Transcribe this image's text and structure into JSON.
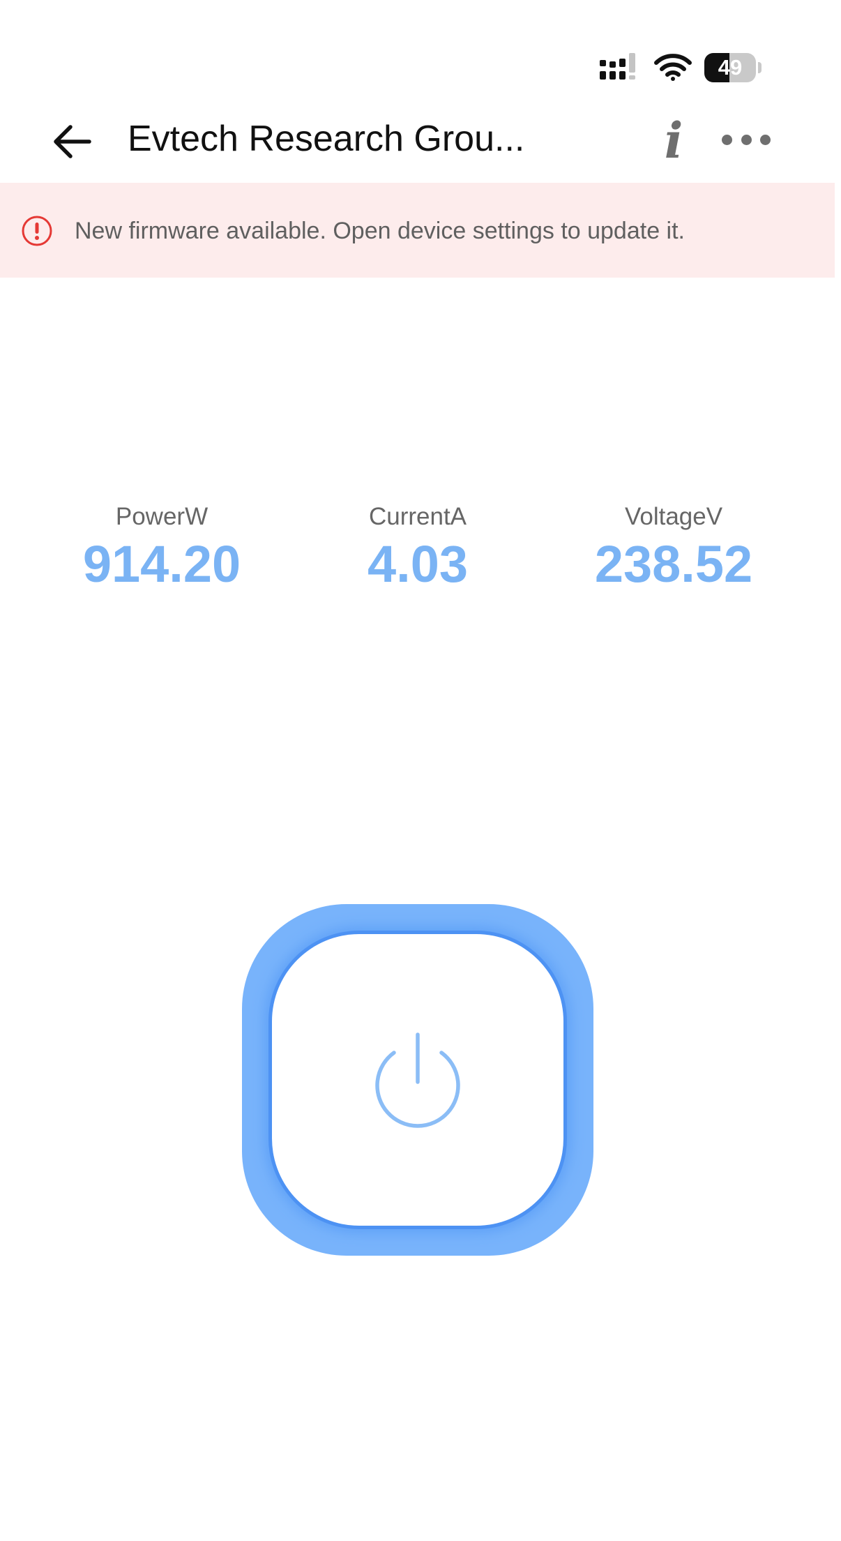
{
  "status_bar": {
    "battery_level": "49",
    "battery_percent": 49
  },
  "header": {
    "title": "Evtech Research Grou...",
    "info_label": "i"
  },
  "banner": {
    "message": "New firmware available. Open device settings to update it."
  },
  "metrics": [
    {
      "label": "PowerW",
      "value": "914.20"
    },
    {
      "label": "CurrentA",
      "value": "4.03"
    },
    {
      "label": "VoltageV",
      "value": "238.52"
    }
  ],
  "colors": {
    "accent": "#78b3fb",
    "metric_value": "#7ab3f4",
    "banner_bg": "#fdecec",
    "alert": "#e53935"
  },
  "icons": {
    "back": "arrow-left-icon",
    "info": "info-icon",
    "more": "more-horizontal-icon",
    "alert": "exclamation-circle-icon",
    "power": "power-icon",
    "signal": "cellular-signal-icon",
    "wifi": "wifi-icon",
    "battery": "battery-icon"
  }
}
